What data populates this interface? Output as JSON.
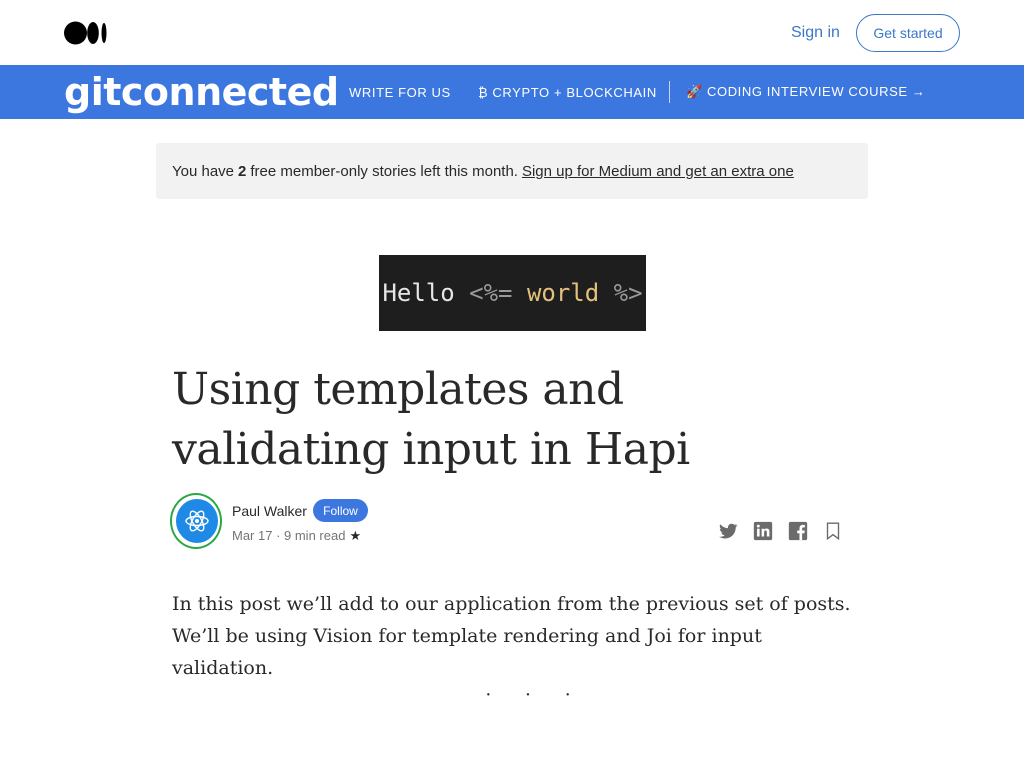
{
  "topbar": {
    "logo_icon": "medium-logo-icon",
    "sign_in": "Sign in",
    "get_started": "Get started",
    "accent": "#3c77c9"
  },
  "publication": {
    "name": "gitconnected",
    "bg_color": "#3c77e0",
    "nav": {
      "write_for_us": "WRITE FOR US",
      "crypto": "₿ CRYPTO + BLOCKCHAIN",
      "coding": "🚀 CODING INTERVIEW COURSE →"
    }
  },
  "banner": {
    "prefix": "You have",
    "count": "2",
    "suffix": "free member-only stories left this month.",
    "link": "Sign up for Medium and get an extra one"
  },
  "hero": {
    "word1": "Hello ",
    "open_tag": "<%=",
    "word2": " world ",
    "close_tag": "%>"
  },
  "article": {
    "title": "Using templates and validating input in Hapi",
    "author": "Paul Walker",
    "follow": "Follow",
    "meta": "Mar 17 · 9 min read",
    "star": "★",
    "body": "In this post we’ll add to our application from the previous set of posts. We’ll be using Vision for template rendering and Joi for input validation.",
    "separator": "· · ·"
  },
  "share_icons": [
    "twitter-icon",
    "linkedin-icon",
    "facebook-icon",
    "bookmark-icon"
  ]
}
